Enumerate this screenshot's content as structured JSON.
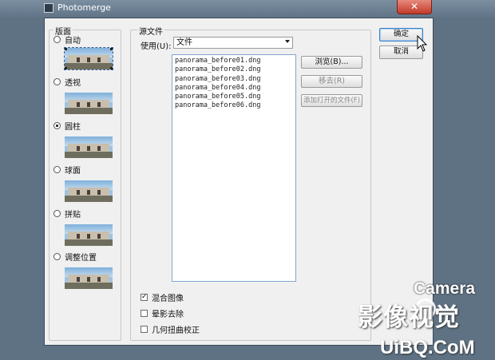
{
  "window": {
    "title": "Photomerge",
    "close_glyph": "✕"
  },
  "layout": {
    "legend": "版面",
    "options": [
      {
        "label": "自动",
        "selected": false
      },
      {
        "label": "透视",
        "selected": false
      },
      {
        "label": "圆柱",
        "selected": true
      },
      {
        "label": "球面",
        "selected": false
      },
      {
        "label": "拼贴",
        "selected": false
      },
      {
        "label": "调整位置",
        "selected": false
      }
    ]
  },
  "source": {
    "legend": "源文件",
    "use_label": "使用(U):",
    "use_value": "文件",
    "files": [
      "panorama_before01.dng",
      "panorama_before02.dng",
      "panorama_before03.dng",
      "panorama_before04.dng",
      "panorama_before05.dng",
      "panorama_before06.dng"
    ],
    "browse_label": "浏览(B)...",
    "remove_label": "移去(R)",
    "add_open_label": "添加打开的文件(F)",
    "checks": [
      {
        "label": "混合图像",
        "checked": true
      },
      {
        "label": "晕影去除",
        "checked": false
      },
      {
        "label": "几何扭曲校正",
        "checked": false
      }
    ]
  },
  "buttons": {
    "ok": "确定",
    "cancel": "取消"
  },
  "watermark": {
    "brand": "Camera",
    "main": "影像视觉",
    "url": "UiBQ.CoM"
  },
  "colors": {
    "titlebar": "#617487",
    "close": "#c23a2a",
    "dialog": "#f0f0f0",
    "accent": "#3b7fc4"
  }
}
